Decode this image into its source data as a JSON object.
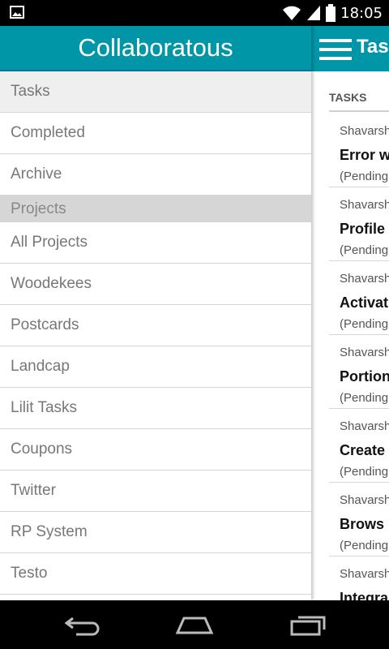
{
  "status_bar": {
    "time": "18:05",
    "icons": [
      "image-icon",
      "wifi-icon",
      "signal-icon",
      "battery-icon"
    ]
  },
  "drawer": {
    "app_title": "Collaboratous",
    "accent_color": "#0096a8",
    "items": [
      {
        "label": "Tasks",
        "active": true
      },
      {
        "label": "Completed"
      },
      {
        "label": "Archive"
      }
    ],
    "projects_header": "Projects",
    "projects": [
      "All Projects",
      "Woodekees",
      "Postcards",
      "Landcap",
      "Lilit Tasks",
      "Coupons",
      "Twitter",
      "RP System",
      "Testo"
    ]
  },
  "tasks_screen": {
    "title": "Tas",
    "section_header": "TASKS",
    "tasks": [
      {
        "owner": "Shavarsh",
        "name": "Error w",
        "status": "(Pending"
      },
      {
        "owner": "Shavarsh",
        "name": "Profile",
        "status": "(Pending"
      },
      {
        "owner": "Shavarsh",
        "name": "Activat",
        "status": "(Pending"
      },
      {
        "owner": "Shavarsh",
        "name": "Portion",
        "status": "(Pending"
      },
      {
        "owner": "Shavarsh",
        "name": "Create",
        "status": "(Pending"
      },
      {
        "owner": "Shavarsh",
        "name": "Brows",
        "status": "(Pending"
      },
      {
        "owner": "Shavarsh",
        "name": "Integra",
        "status": ""
      }
    ]
  },
  "nav_bar": {
    "buttons": [
      "back-icon",
      "home-icon",
      "recent-apps-icon"
    ]
  }
}
